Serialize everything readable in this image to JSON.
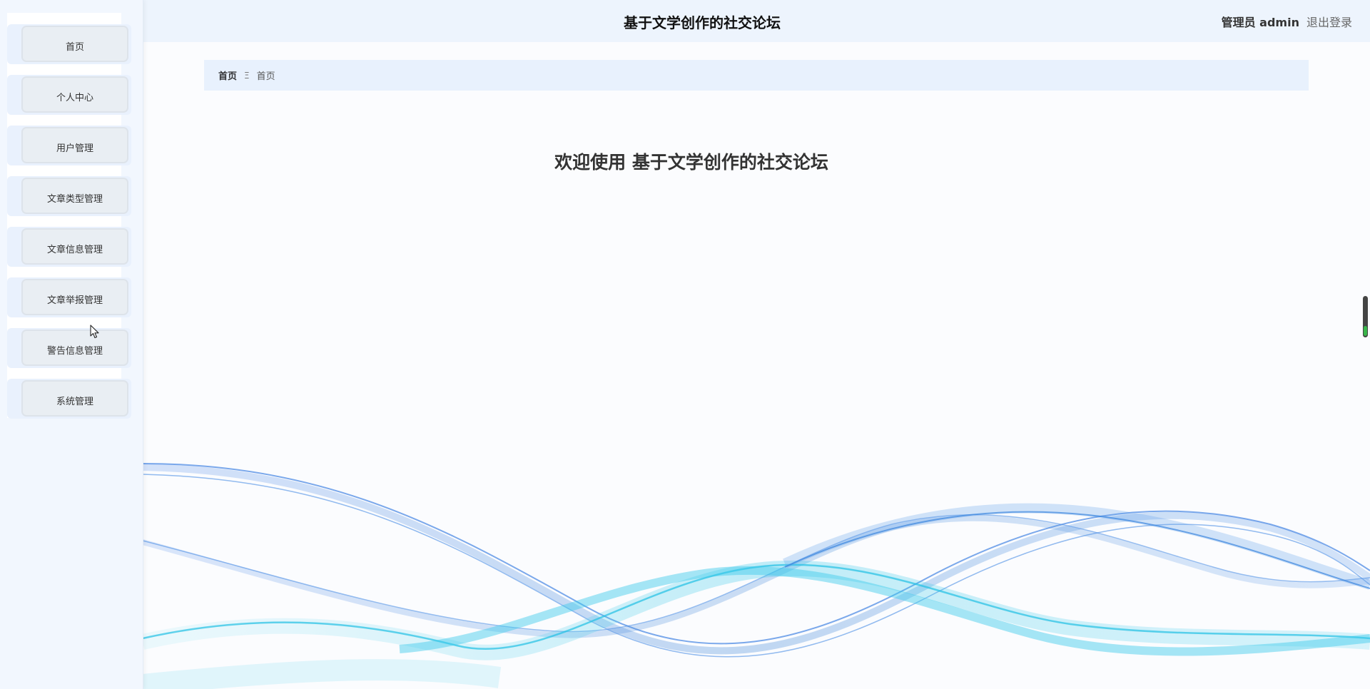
{
  "header": {
    "title": "基于文学创作的社交论坛",
    "role": "管理员 admin",
    "logout": "退出登录"
  },
  "sidebar": {
    "items": [
      {
        "label": "首页"
      },
      {
        "label": "个人中心"
      },
      {
        "label": "用户管理"
      },
      {
        "label": "文章类型管理"
      },
      {
        "label": "文章信息管理"
      },
      {
        "label": "文章举报管理"
      },
      {
        "label": "警告信息管理"
      },
      {
        "label": "系统管理"
      }
    ]
  },
  "breadcrumb": {
    "home": "首页",
    "separator": "Ξ",
    "current": "首页"
  },
  "main": {
    "welcome": "欢迎使用 基于文学创作的社交论坛"
  },
  "colors": {
    "sidebar_bg": "#f2f7fe",
    "header_bg": "#edf4fd",
    "breadcrumb_bg": "#e8f1fd",
    "menu_item_bg": "#e9eef3",
    "wave_blue": "#4a8fe7",
    "wave_cyan": "#35c6e8"
  }
}
